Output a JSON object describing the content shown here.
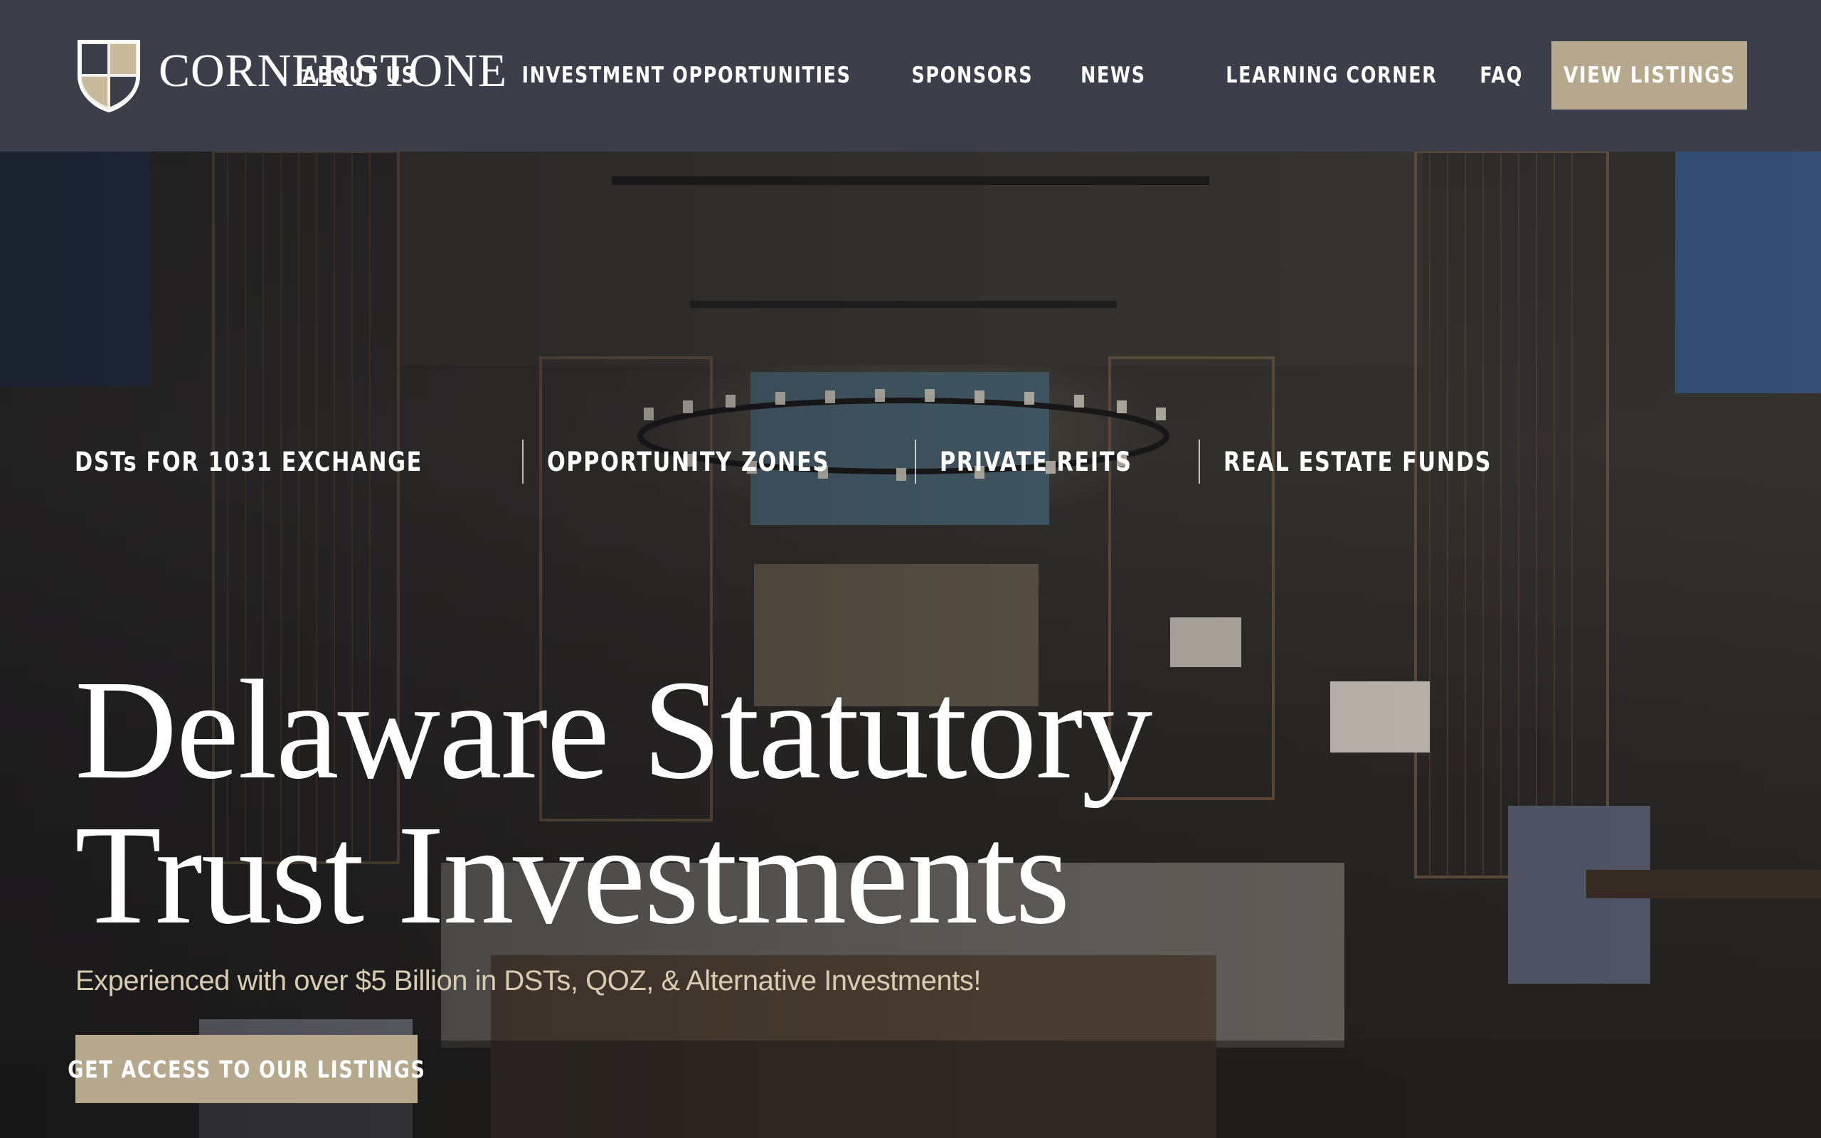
{
  "brand": {
    "name": "CORNERSTONE",
    "logo_icon": "shield-icon"
  },
  "nav": {
    "items": [
      {
        "label": "ABOUT US"
      },
      {
        "label": "INVESTMENT OPPORTUNITIES"
      },
      {
        "label": "SPONSORS"
      },
      {
        "label": "NEWS"
      },
      {
        "label": "LEARNING CORNER"
      },
      {
        "label": "FAQ"
      }
    ],
    "cta_label": "VIEW LISTINGS"
  },
  "hero": {
    "tags": [
      {
        "label": "DSTs FOR 1031 EXCHANGE"
      },
      {
        "label": "OPPORTUNITY ZONES"
      },
      {
        "label": "PRIVATE REITS"
      },
      {
        "label": "REAL ESTATE FUNDS"
      }
    ],
    "headline_line1": "Delaware Statutory",
    "headline_line2": "Trust Investments",
    "subtitle": "Experienced with over $5 Billion in DSTs, QOZ, & Alternative Investments!",
    "cta_label": "GET ACCESS TO OUR LISTINGS"
  },
  "colors": {
    "header_bg": "#3c3e4a",
    "accent": "#b5a88c",
    "subtitle": "#d8ccb0"
  }
}
